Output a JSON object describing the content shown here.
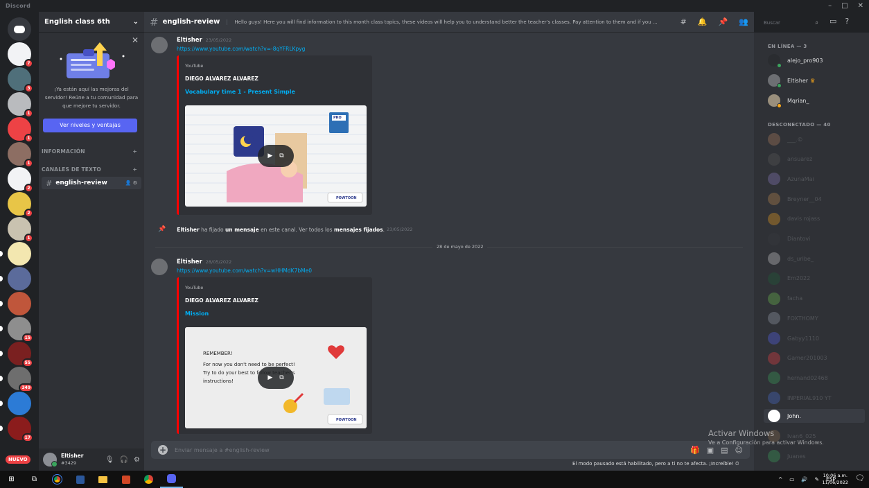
{
  "window": {
    "title": "Discord",
    "controls": [
      "–",
      "□",
      "✕"
    ]
  },
  "guilds": [
    {
      "name": "home",
      "color": "#36393f",
      "label": "",
      "badge": ""
    },
    {
      "name": "server-1",
      "color": "#f2f3f5",
      "label": "",
      "badge": "7"
    },
    {
      "name": "server-2",
      "color": "#4f6f7a",
      "label": "",
      "badge": "3"
    },
    {
      "name": "server-3",
      "color": "#b9bbbe",
      "label": "",
      "badge": "1"
    },
    {
      "name": "server-4",
      "color": "#ed4245",
      "label": "",
      "badge": "1"
    },
    {
      "name": "server-5",
      "color": "#8d6e63",
      "label": "",
      "badge": "1"
    },
    {
      "name": "server-6",
      "color": "#f2f3f5",
      "label": "",
      "badge": "2"
    },
    {
      "name": "server-7",
      "color": "#e8c547",
      "label": "",
      "badge": "2"
    },
    {
      "name": "server-8",
      "color": "#c9c2b0",
      "label": "",
      "badge": "1"
    },
    {
      "name": "server-9",
      "color": "#f3e7b0",
      "label": "",
      "badge": ""
    },
    {
      "name": "server-10",
      "color": "#5b6b9b",
      "label": "",
      "badge": ""
    },
    {
      "name": "server-11",
      "color": "#c0563b",
      "label": "",
      "badge": ""
    },
    {
      "name": "server-12",
      "color": "#8e8e8e",
      "label": "",
      "badge": "15"
    },
    {
      "name": "server-13",
      "color": "#7a2020",
      "label": "",
      "badge": "55"
    },
    {
      "name": "server-14",
      "color": "#6e6e6e",
      "label": "",
      "badge": "349"
    },
    {
      "name": "server-15",
      "color": "#2c7bd6",
      "label": "",
      "badge": ""
    },
    {
      "name": "server-16",
      "color": "#8b1c1c",
      "label": "",
      "badge": "17"
    }
  ],
  "guild_new_badge": "NUEVO",
  "server": {
    "name": "English class 6th",
    "boost_text": "¡Ya están aquí las mejoras del servidor! Reúne a tu comunidad para que mejore tu servidor.",
    "boost_button": "Ver niveles y ventajas",
    "categories": [
      {
        "label": "INFORMACIÓN",
        "add": "+"
      },
      {
        "label": "CANALES DE TEXTO",
        "add": "+"
      }
    ],
    "channels": [
      {
        "name": "english-review"
      }
    ]
  },
  "user": {
    "name": "Eltisher",
    "tag": "#3429"
  },
  "channel": {
    "name": "english-review",
    "topic": "Hello guys! Here you will find information to this month class topics, these videos will help you to understand better the teacher's classes. Pay attention to them and if you ..."
  },
  "search": {
    "placeholder": "Buscar"
  },
  "messages": [
    {
      "author": "Eltisher",
      "time": "23/05/2022",
      "link": "https://www.youtube.com/watch?v=-8qYFRLKpyg",
      "embed": {
        "provider": "YouTube",
        "author": "DIEGO ALVAREZ ALVAREZ",
        "title": "Vocabulary time 1 - Present Simple",
        "badge": "PRO"
      }
    },
    {
      "author": "Eltisher",
      "time": "28/05/2022",
      "link": "https://www.youtube.com/watch?v=wHHMdK7bMe0",
      "embed": {
        "provider": "YouTube",
        "author": "DIEGO ALVAREZ ALVAREZ",
        "title": "Mission",
        "note_title": "REMEMBER!",
        "note_line1": "For now you don't need to be perfect!",
        "note_line2": "Try to do your best to follow teacher's",
        "note_line3": "instructions!"
      }
    }
  ],
  "thumb_brand": "POWTOON",
  "pin_notice": {
    "author": "Eltisher",
    "text1": "ha fijado",
    "link1": "un mensaje",
    "text2": "en este canal. Ver todos los",
    "link2": "mensajes fijados",
    "time": "23/05/2022"
  },
  "date_divider": "28 de mayo de 2022",
  "composer": {
    "placeholder": "Enviar mensaje a #english-review"
  },
  "pause_notice": "El modo pausado está habilitado, pero a ti no te afecta. ¡Increíble!",
  "members": {
    "online_header": "EN LÍNEA — 3",
    "online": [
      {
        "name": "alejo_pro903",
        "color": "#2a2c30",
        "status": "online"
      },
      {
        "name": "Eltisher",
        "color": "#6d6f73",
        "status": "online",
        "crown": "♛"
      },
      {
        "name": "Mqrian_",
        "color": "#9a8f7c",
        "status": "idle"
      }
    ],
    "offline_header": "DESCONECTADO — 40",
    "offline": [
      {
        "name": "___.©",
        "color": "#b08060"
      },
      {
        "name": "ansuarez",
        "color": "#5a5a5a"
      },
      {
        "name": "AzunaMai",
        "color": "#8b7bc0"
      },
      {
        "name": "Breyner__04",
        "color": "#c08b50"
      },
      {
        "name": "davis rojass",
        "color": "#f0a020"
      },
      {
        "name": "Diantovi",
        "color": "#3a3c40"
      },
      {
        "name": "ds_uribe_",
        "color": "#d0d0d0"
      },
      {
        "name": "Em2022",
        "color": "#1e5f3a"
      },
      {
        "name": "facha",
        "color": "#70c050"
      },
      {
        "name": "FOXTHOMY",
        "color": "#9aa0b0"
      },
      {
        "name": "Gabyy1110",
        "color": "#5865f2"
      },
      {
        "name": "Gamer201003",
        "color": "#ed4245"
      },
      {
        "name": "hernand02468",
        "color": "#3ba55d"
      },
      {
        "name": "INPERIAL910 YT",
        "color": "#4a6fd0"
      }
    ],
    "selected": {
      "name": "John.",
      "color": "#ffffff"
    },
    "after": [
      {
        "name": "Ivan6_025",
        "color": "#8b6d50"
      },
      {
        "name": "Juanes",
        "color": "#3ba55d"
      }
    ]
  },
  "watermark": {
    "line1": "Activar Windows",
    "line2": "Ve a Configuración para activar Windows."
  },
  "taskbar": {
    "tray_lang": "ESP",
    "time": "10:06 a.m.",
    "date": "11/06/2022",
    "notif_count": "2"
  }
}
